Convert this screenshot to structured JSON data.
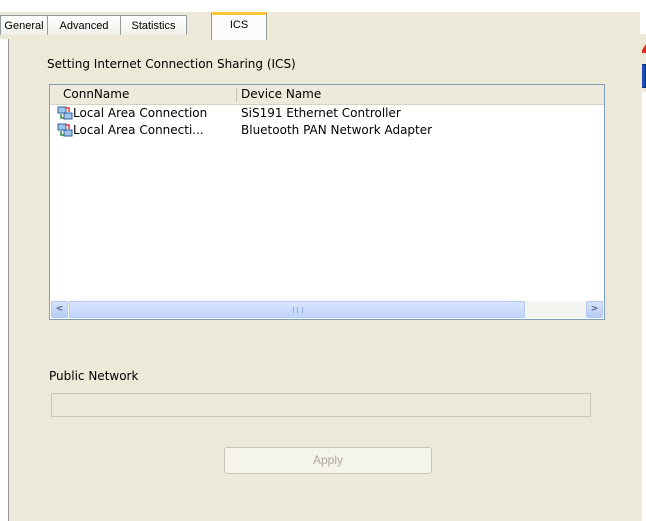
{
  "tabs": [
    {
      "label": "General",
      "active": false
    },
    {
      "label": "Advanced",
      "active": false
    },
    {
      "label": "Statistics",
      "active": false
    },
    {
      "label": "ICS",
      "active": true
    }
  ],
  "ics": {
    "section_title": "Setting Internet Connection Sharing (ICS)",
    "columns": [
      "ConnName",
      "Device Name"
    ],
    "rows": [
      {
        "name": "Local Area Connection",
        "device": "SiS191 Ethernet Controller",
        "icon": "network-connection-icon"
      },
      {
        "name": "Local Area Connecti...",
        "device": "Bluetooth PAN Network Adapter",
        "icon": "network-connection-icon"
      }
    ],
    "public_network_label": "Public Network",
    "public_network_value": "",
    "apply_label": "Apply",
    "apply_enabled": false
  },
  "colors": {
    "tab_highlight": "#ffc83c",
    "panel_bg": "#ece9d8",
    "list_border": "#7f9db9"
  }
}
